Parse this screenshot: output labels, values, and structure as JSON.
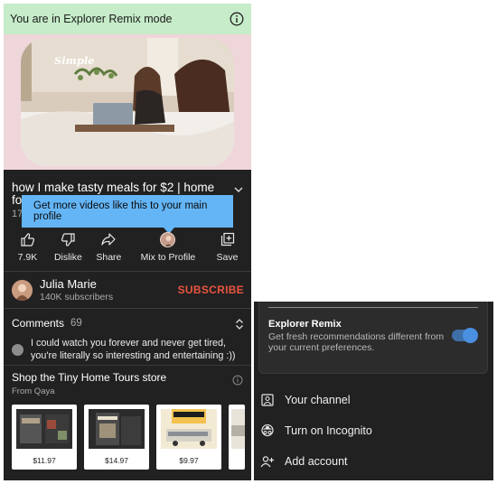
{
  "left": {
    "mode_bar": {
      "text": "You are in Explorer Remix mode",
      "info_icon": "info-icon"
    },
    "video": {
      "thumbnail_caption": "Simple"
    },
    "title": "how I make tasty meals for $2 | home fo...",
    "meta_partial": "17",
    "tooltip": "Get more videos like this to your main profile",
    "actions": [
      {
        "icon": "like-icon",
        "label": "7.9K"
      },
      {
        "icon": "dislike-icon",
        "label": "Dislike"
      },
      {
        "icon": "share-icon",
        "label": "Share"
      },
      {
        "icon": "avatar-icon",
        "label": "Mix to Profile"
      },
      {
        "icon": "save-icon",
        "label": "Save"
      }
    ],
    "channel": {
      "name": "Julia Marie",
      "subscribers": "140K subscribers",
      "subscribe_label": "SUBSCRIBE"
    },
    "comments": {
      "label": "Comments",
      "count": "69",
      "top_comment": "I could watch you forever and never get tired, you're literally so interesting and entertaining :))"
    },
    "shop": {
      "title": "Shop the Tiny Home Tours store",
      "subtitle": "From Qaya",
      "products": [
        {
          "price": "$11.97"
        },
        {
          "price": "$14.97",
          "badge": "TINY HOME TOURS"
        },
        {
          "price": "$9.97",
          "badge": "SKOOLIE"
        }
      ]
    }
  },
  "right": {
    "remix": {
      "title": "Explorer Remix",
      "description": "Get fresh recommendations different from your current preferences.",
      "enabled": true
    },
    "menu": [
      {
        "icon": "person-icon",
        "label": "Your channel"
      },
      {
        "icon": "incognito-icon",
        "label": "Turn on Incognito"
      },
      {
        "icon": "add-account-icon",
        "label": "Add account"
      }
    ]
  },
  "colors": {
    "mode_bar_bg": "#c6ecc9",
    "dark_bg": "#212121",
    "tooltip_bg": "#64b5f6",
    "subscribe": "#e8553f",
    "toggle": "#4a8fe0"
  }
}
